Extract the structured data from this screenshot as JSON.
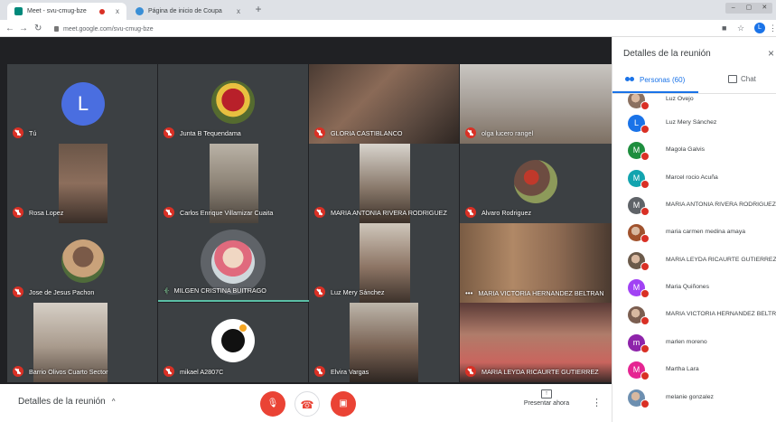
{
  "browser": {
    "tabs": [
      {
        "title": "Meet - svu-cmug-bze",
        "close": "x",
        "active": true
      },
      {
        "title": "Página de inicio de Coupa",
        "close": "x",
        "active": false
      }
    ],
    "new_tab": "+",
    "url": "meet.google.com/svu-cmug-bze",
    "profile_initial": "L"
  },
  "tiles": [
    {
      "name": "Tú",
      "state": "muted",
      "avatar_letter": "L",
      "avatar_color": "#4a6ee0"
    },
    {
      "name": "Junta B Tequendama",
      "state": "muted"
    },
    {
      "name": "GLORIA CASTIBLANCO",
      "state": "muted"
    },
    {
      "name": "olga lucero rangel",
      "state": "muted"
    },
    {
      "name": "Rosa Lopez",
      "state": "muted"
    },
    {
      "name": "Carlos Enrique Villamizar Cuaita",
      "state": "muted"
    },
    {
      "name": "MARIA ANTONIA RIVERA RODRIGUEZ",
      "state": "muted"
    },
    {
      "name": "Alvaro Rodriguez",
      "state": "muted"
    },
    {
      "name": "Jose de Jesus Pachon",
      "state": "muted"
    },
    {
      "name": "MILGEN CRISTINA BUITRAGO",
      "state": "speaking"
    },
    {
      "name": "Luz Mery Sánchez",
      "state": "muted"
    },
    {
      "name": "MARIA VICTORIA HERNANDEZ BELTRAN",
      "state": "dots"
    },
    {
      "name": "Barrio Olivos Cuarto Sector",
      "state": "muted"
    },
    {
      "name": "mikael A2807C",
      "state": "muted"
    },
    {
      "name": "Elvira Vargas",
      "state": "muted"
    },
    {
      "name": "MARIA LEYDA RICAURTE GUTIERREZ",
      "state": "muted"
    }
  ],
  "bottom_bar": {
    "details_label": "Detalles de la reunión",
    "details_chevron": "^",
    "present_label": "Presentar ahora",
    "more": "⋮"
  },
  "panel": {
    "title": "Detalles de la reunión",
    "close": "×",
    "people_tab": "Personas (60)",
    "chat_tab": "Chat",
    "participants": [
      {
        "name": "Luz Ovejo",
        "initial": "",
        "color": "#8a7060",
        "photo": true
      },
      {
        "name": "Luz Mery Sánchez",
        "initial": "L",
        "color": "#1a73e8",
        "photo": false
      },
      {
        "name": "Magola Galvis",
        "initial": "M",
        "color": "#1e8e3e",
        "photo": false
      },
      {
        "name": "Marcel rocio Acuña",
        "initial": "M",
        "color": "#12a4af",
        "photo": false
      },
      {
        "name": "MARIA ANTONIA RIVERA RODRIGUEZ",
        "initial": "M",
        "color": "#5f6368",
        "photo": false
      },
      {
        "name": "maria carmen medina amaya",
        "initial": "",
        "color": "#a0522d",
        "photo": true
      },
      {
        "name": "MARIA LEYDA RICAURTE GUTIERREZ",
        "initial": "",
        "color": "#6b5a4a",
        "photo": true
      },
      {
        "name": "Maria Quiñones",
        "initial": "M",
        "color": "#a142f4",
        "photo": false
      },
      {
        "name": "MARIA VICTORIA HERNANDEZ BELTR...",
        "initial": "",
        "color": "#7b5e50",
        "photo": true
      },
      {
        "name": "marlen moreno",
        "initial": "m",
        "color": "#8e24aa",
        "photo": false
      },
      {
        "name": "Martha Lara",
        "initial": "M",
        "color": "#e52592",
        "photo": false
      },
      {
        "name": "melanie gonzalez",
        "initial": "",
        "color": "#6d8fb0",
        "photo": true
      }
    ]
  }
}
